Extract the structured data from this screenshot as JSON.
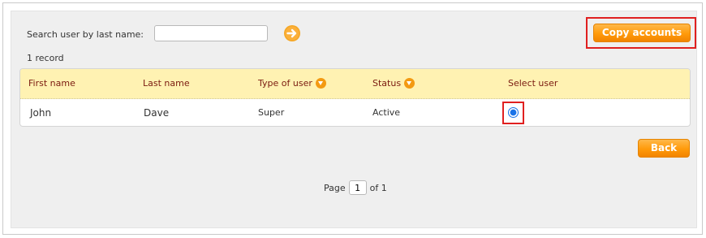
{
  "search": {
    "label": "Search user by last name:",
    "value": "",
    "go_icon": "arrow-right-circle-icon"
  },
  "record_count": "1 record",
  "buttons": {
    "copy_accounts": "Copy accounts",
    "back": "Back"
  },
  "table": {
    "headers": {
      "first_name": "First name",
      "last_name": "Last name",
      "type_of_user": "Type of user",
      "status": "Status",
      "select_user": "Select user"
    },
    "rows": [
      {
        "first_name": "John",
        "last_name": "Dave",
        "type_of_user": "Super",
        "status": "Active",
        "selected": true
      }
    ]
  },
  "pagination": {
    "page_label": "Page",
    "current_page": "1",
    "of_label": "of 1"
  },
  "colors": {
    "accent_orange": "#ff9a0a",
    "header_bg": "#fff2b2",
    "header_text": "#7a1a0f",
    "highlight_red": "#e02020"
  }
}
